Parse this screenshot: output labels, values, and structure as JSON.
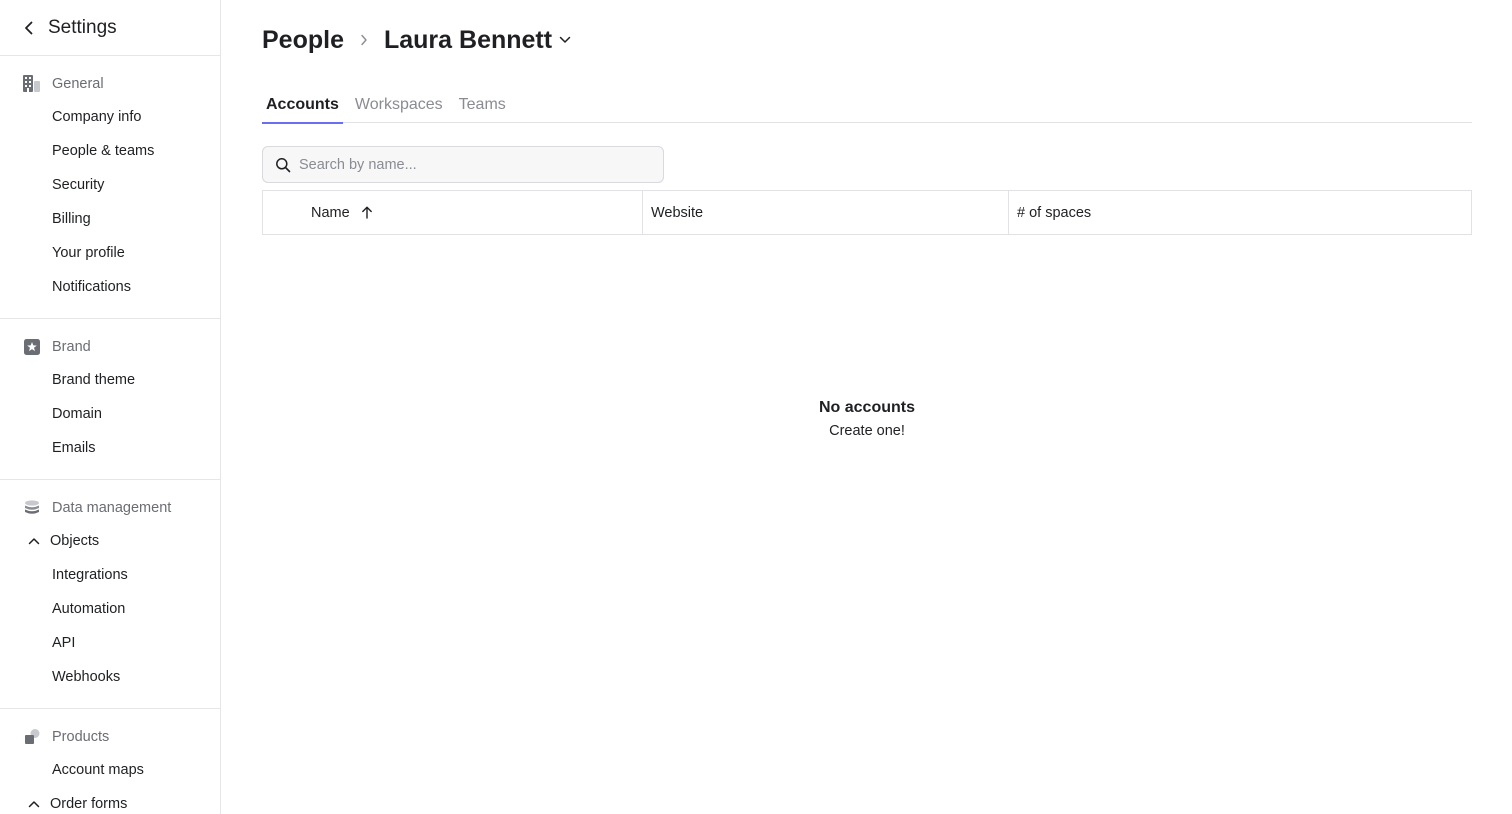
{
  "sidebar": {
    "title": "Settings",
    "sections": {
      "general": {
        "label": "General",
        "icon": "building-icon",
        "items": [
          "Company info",
          "People & teams",
          "Security",
          "Billing",
          "Your profile",
          "Notifications"
        ]
      },
      "brand": {
        "label": "Brand",
        "icon": "star-badge-icon",
        "items": [
          "Brand theme",
          "Domain",
          "Emails"
        ]
      },
      "data": {
        "label": "Data management",
        "icon": "database-icon",
        "objects": "Objects",
        "items": [
          "Integrations",
          "Automation",
          "API",
          "Webhooks"
        ]
      },
      "products": {
        "label": "Products",
        "icon": "shapes-icon",
        "items": [
          "Account maps"
        ],
        "order_forms": "Order forms"
      }
    }
  },
  "breadcrumb": {
    "parent": "People",
    "current": "Laura Bennett"
  },
  "tabs": [
    "Accounts",
    "Workspaces",
    "Teams"
  ],
  "active_tab": "Accounts",
  "search": {
    "placeholder": "Search by name..."
  },
  "table": {
    "columns": [
      "Name",
      "Website",
      "# of spaces"
    ],
    "sort_column": "Name",
    "sort_direction": "ascending"
  },
  "empty_state": {
    "title": "No accounts",
    "action": "Create one!"
  },
  "colors": {
    "accent": "#6a6ef0",
    "border": "#e2e2e6",
    "muted_text": "#6b6d74"
  }
}
